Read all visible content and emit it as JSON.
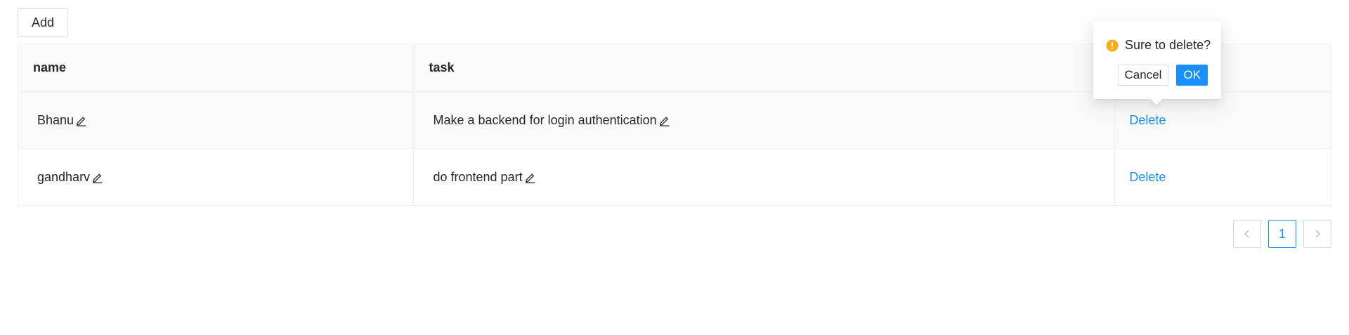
{
  "toolbar": {
    "add_label": "Add"
  },
  "table": {
    "columns": [
      "name",
      "task",
      ""
    ],
    "rows": [
      {
        "name": "Bhanu",
        "task": "Make a backend for login authentication",
        "action": "Delete"
      },
      {
        "name": "gandharv",
        "task": "do frontend part",
        "action": "Delete"
      }
    ]
  },
  "popconfirm": {
    "title": "Sure to delete?",
    "cancel_label": "Cancel",
    "ok_label": "OK",
    "icon": "exclamation-circle-icon"
  },
  "pagination": {
    "current_page": "1",
    "prev_icon": "chevron-left-icon",
    "next_icon": "chevron-right-icon"
  },
  "colors": {
    "accent": "#1890ff",
    "warning": "#faad14"
  }
}
